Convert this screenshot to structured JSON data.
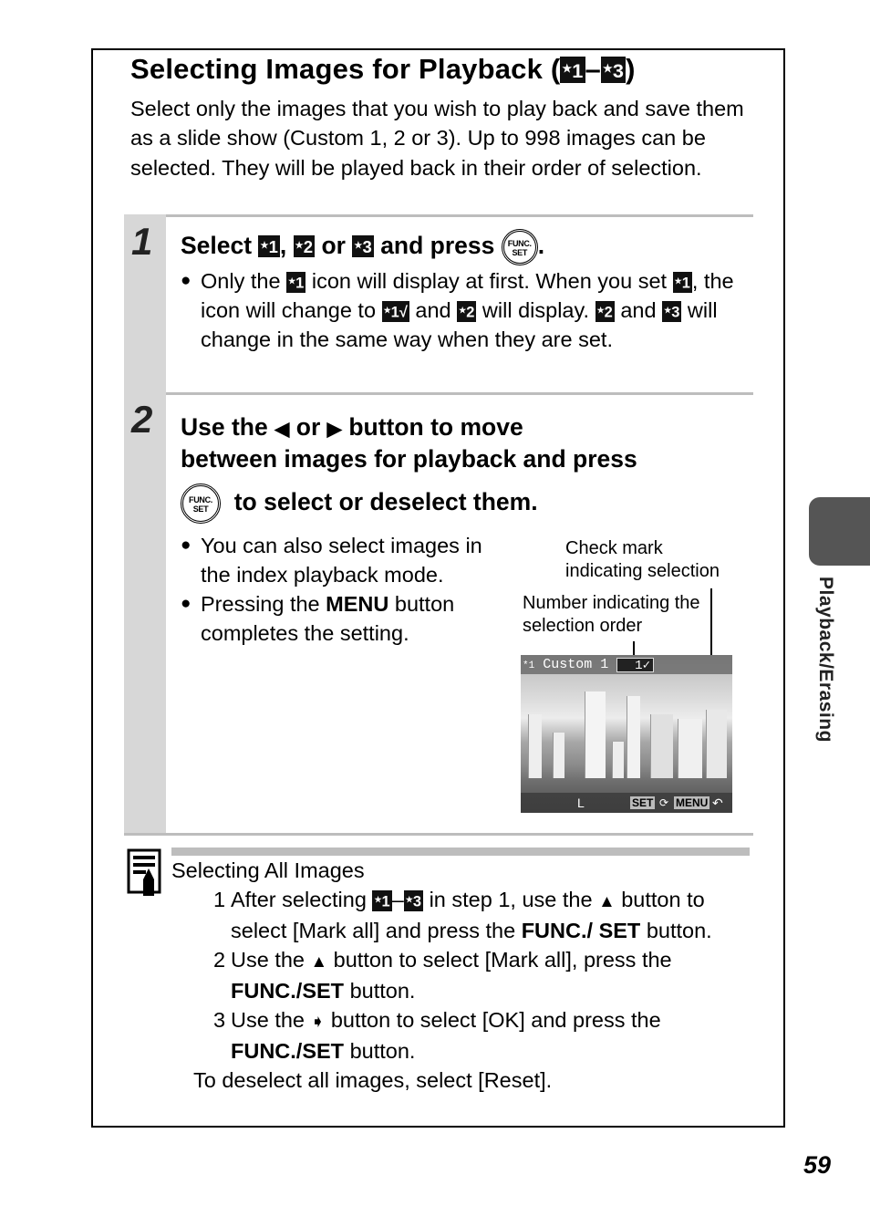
{
  "section": {
    "title": "Selecting Images for Playback (",
    "title_icon_1": "1",
    "title_dash": "–",
    "title_icon_3": "3",
    "title_close": ")",
    "intro": "Select only the images that you wish to play back and save them as a slide show (Custom 1, 2 or 3). Up to 998 images can be selected. They will be played back in their order of selection."
  },
  "steps": [
    {
      "number": "1",
      "heading": {
        "part1": "Select",
        "icon1": "1",
        "comma": ",",
        "icon2": "2",
        "or": "or",
        "icon3": "3",
        "and_press": "and press",
        "button": {
          "line1": "FUNC.",
          "line2": "SET"
        },
        "period": "."
      },
      "bullet": {
        "t1": "Only the",
        "i1": "1",
        "t2": "icon will display at first. When you set",
        "i2": "1",
        "t3": ", the icon will change to",
        "i3": "1√",
        "t4": "and",
        "i4": "2",
        "t5": "will display.",
        "i5": "2",
        "t6": "and",
        "i6": "3",
        "t7": "will change in the same way when they are set."
      }
    },
    {
      "number": "2",
      "heading": {
        "part1": "Use the",
        "left_arrow": "◆",
        "or": "or",
        "right_arrow": "◆",
        "part2": "button to move",
        "line2": "between images for playback and press",
        "button": {
          "line1": "FUNC.",
          "line2": "SET"
        },
        "line3": "to select or deselect them."
      },
      "bullets": [
        {
          "text": "You can also select images in the index playback mode."
        },
        {
          "pre": "Pressing the ",
          "bold": "MENU",
          "post": " button completes the setting."
        }
      ],
      "annotations": {
        "check_mark": "Check mark indicating selection",
        "number": "Number indicating the selection order"
      },
      "screen": {
        "mode_icon": "*1",
        "mode_label": "Custom 1",
        "order_number": "1",
        "check": "✓",
        "size_label": "L",
        "set_label": "SET",
        "menu_label": "MENU",
        "return_icon": "↶"
      }
    }
  ],
  "tip": {
    "title": "Selecting All Images",
    "items": [
      {
        "n": "1",
        "t1": "After selecting",
        "i1": "1",
        "dash": "–",
        "i2": "3",
        "t2": "in step 1, use the",
        "arrow": "▲",
        "t3": "button to select [Mark all] and press the",
        "b1": "FUNC./",
        "b2": "SET",
        "t4": "button."
      },
      {
        "n": "2",
        "t1": "Use the",
        "arrow": "▲",
        "t2": "button to select [Mark all], press the",
        "b1": "FUNC./SET",
        "t3": "button."
      },
      {
        "n": "3",
        "t1": "Use the",
        "arrow": "➧",
        "t2": "button to select [OK] and press the",
        "b1": "FUNC./SET",
        "t3": "button."
      }
    ],
    "footer": "To deselect all images, select [Reset]."
  },
  "side_tab": {
    "label": "Playback/Erasing"
  },
  "page_number": "59"
}
